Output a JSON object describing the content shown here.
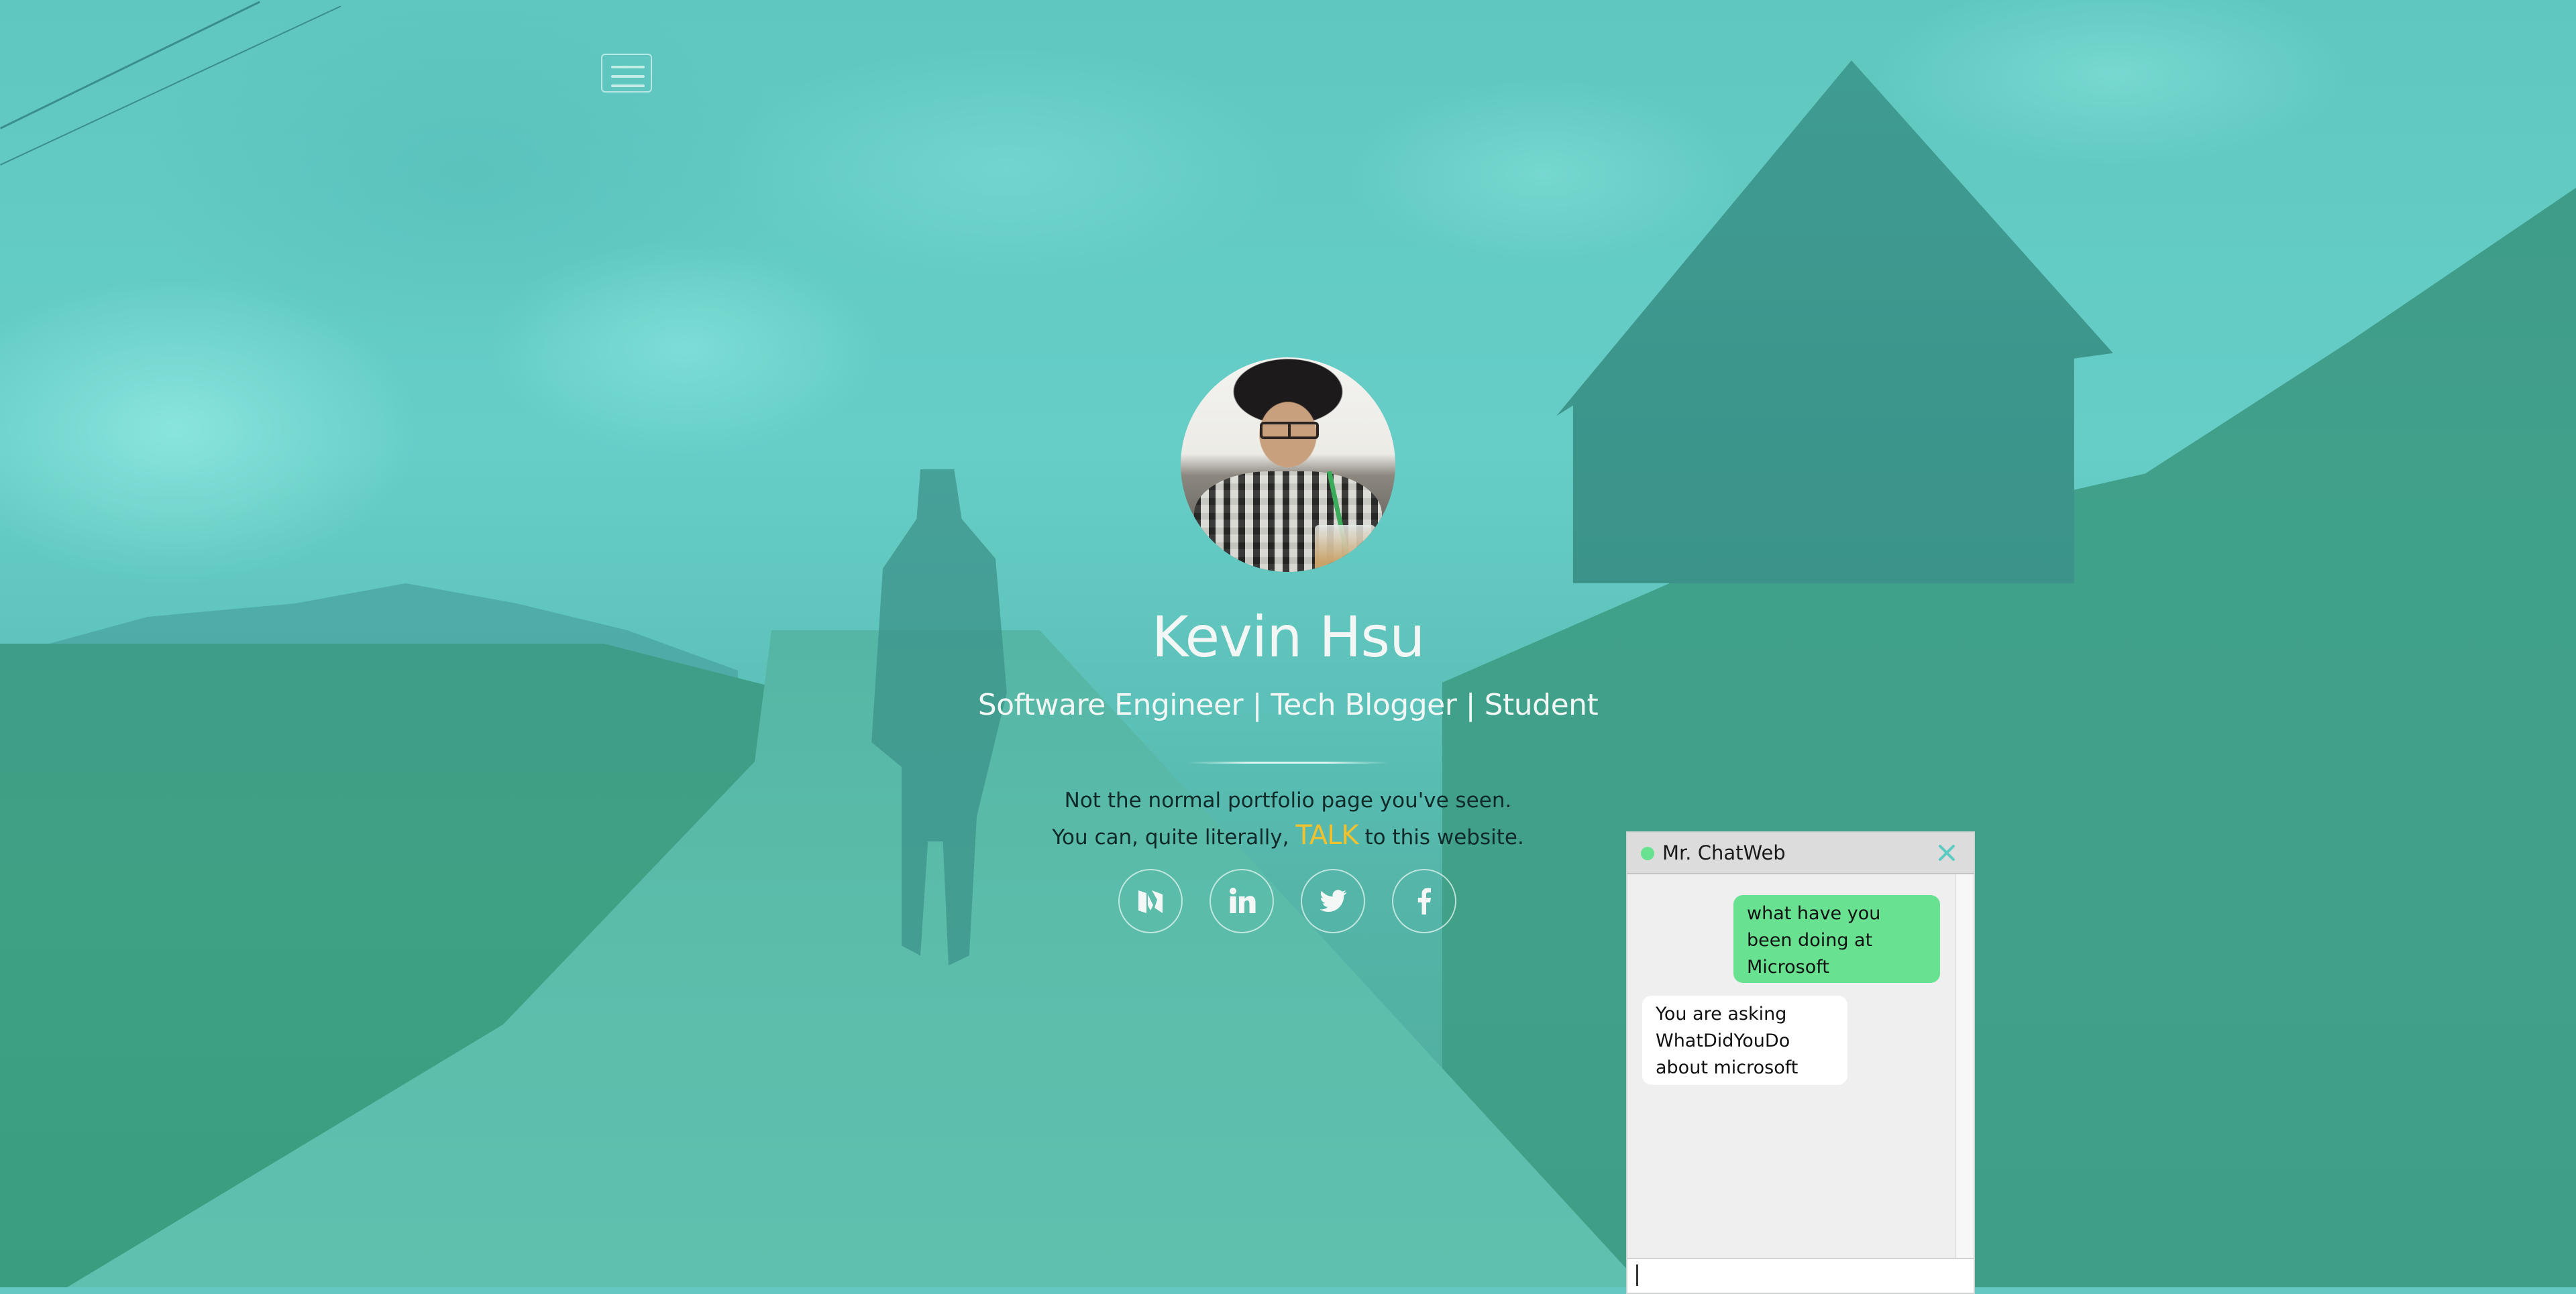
{
  "nav": {
    "menu_icon": "hamburger-menu-icon"
  },
  "hero": {
    "avatar_alt": "Profile photo",
    "name": "Kevin Hsu",
    "roles": "Software Engineer | Tech Blogger | Student",
    "tagline_line1": "Not the normal portfolio page you've seen.",
    "tagline_line2_before": "You can, quite literally,",
    "tagline_highlight": "TALK",
    "tagline_line2_after": "to this website.",
    "highlight_color": "#f2c12e"
  },
  "social": [
    {
      "name": "Medium",
      "icon": "medium-icon"
    },
    {
      "name": "LinkedIn",
      "icon": "linkedin-icon"
    },
    {
      "name": "Twitter",
      "icon": "twitter-icon"
    },
    {
      "name": "Facebook",
      "icon": "facebook-icon"
    }
  ],
  "chat": {
    "title": "Mr. ChatWeb",
    "status": "online",
    "status_color": "#68e190",
    "close_icon": "close-icon",
    "messages": [
      {
        "from": "user",
        "text": "what have you been doing at Microsoft"
      },
      {
        "from": "bot",
        "text": "You are asking WhatDidYouDo about microsoft"
      }
    ],
    "input_value": "",
    "user_bubble_color": "#68e190",
    "bot_bubble_color": "#ffffff"
  }
}
